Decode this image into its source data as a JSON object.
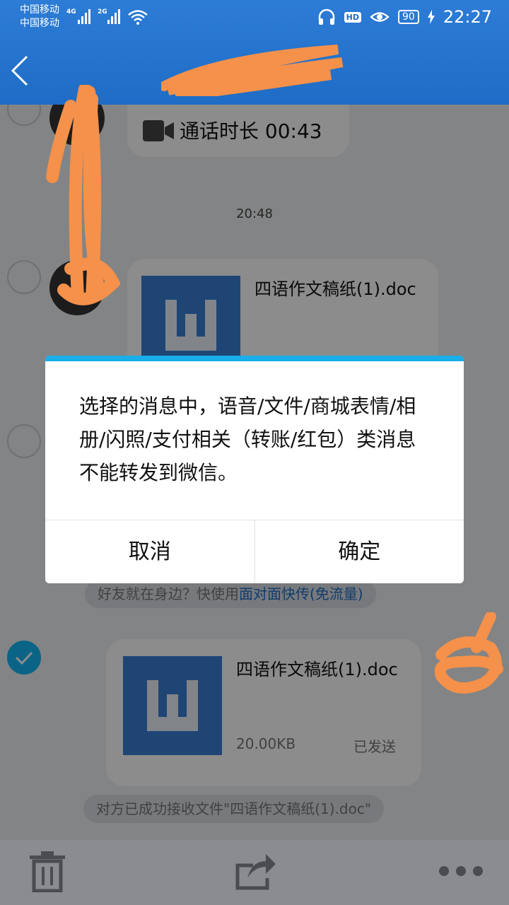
{
  "status_bar": {
    "carrier_1": "中国移动",
    "carrier_2": "中国移动",
    "network_1": "4G",
    "network_2": "2G",
    "hd_badge": "HD",
    "battery": "90",
    "time": "22:27"
  },
  "chat": {
    "call_message": "通话时长 00:43",
    "time_divider": "20:48",
    "file_1": {
      "name": "四语作文稿纸(1).doc"
    },
    "tip_face_to_face": {
      "prefix": "好友就在身边？快使用",
      "link": "面对面快传(免流量)"
    },
    "file_2": {
      "name": "四语作文稿纸(1).doc",
      "size": "20.00KB",
      "status": "已发送"
    },
    "tip_received": "对方已成功接收文件\"四语作文稿纸(1).doc\""
  },
  "dialog": {
    "message": "选择的消息中，语音/文件/商城表情/相册/闪照/支付相关（转账/红包）类消息不能转发到微信。",
    "cancel_label": "取消",
    "confirm_label": "确定"
  },
  "colors": {
    "header_blue": "#1e6cc5",
    "accent_cyan": "#19aeea",
    "file_icon_blue": "#3a7ed6",
    "check_blue": "#12b7f5",
    "scribble_orange": "#f5914a"
  },
  "icons": [
    "back-arrow-icon",
    "video-camera-icon",
    "word-doc-icon",
    "trash-icon",
    "share-icon",
    "more-dots-icon",
    "checkmark-icon"
  ]
}
